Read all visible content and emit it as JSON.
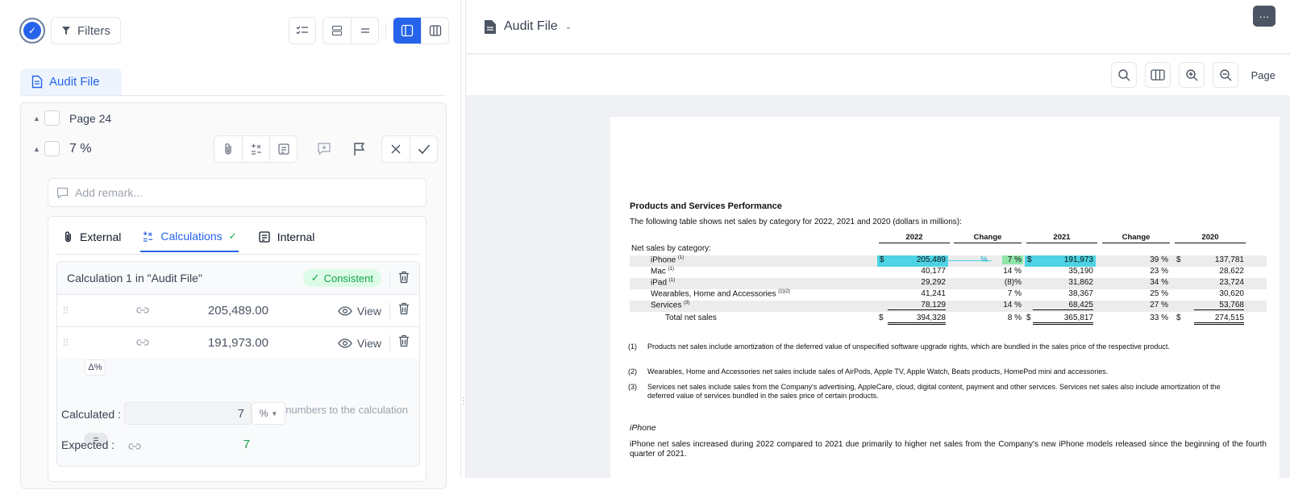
{
  "left": {
    "filters_label": "Filters",
    "audit_tab_label": "Audit File",
    "page_label": "Page 24",
    "item_label": "7 %",
    "remark_placeholder": "Add remark...",
    "tabs": [
      {
        "label": "External"
      },
      {
        "label": "Calculations"
      },
      {
        "label": "Internal"
      }
    ],
    "calc": {
      "title": "Calculation 1 in \"Audit File\"",
      "status": "Consistent",
      "operator": "Δ%",
      "numbers": [
        {
          "value": "205,489.00",
          "view_label": "View"
        },
        {
          "value": "191,973.00",
          "view_label": "View"
        }
      ],
      "add_numbers_label": "Add numbers to the calculation",
      "equals": "=",
      "calculated_label": "Calculated :",
      "calculated_value": "7",
      "unit": "%",
      "expected_label": "Expected :",
      "expected_value": "7"
    }
  },
  "right": {
    "title": "Audit File",
    "more_label": "···",
    "page_label": "Page"
  },
  "document": {
    "title": "Products and Services Performance",
    "subtitle": "The following table shows net sales by category for 2022, 2021 and 2020 (dollars in millions):",
    "headers": [
      "2022",
      "Change",
      "2021",
      "Change",
      "2020"
    ],
    "section_label": "Net sales by category:",
    "rows": [
      {
        "label": "iPhone",
        "sup": "(1)",
        "d1": "$",
        "v2022": "205,489",
        "chg1": "7 %",
        "d2": "$",
        "v2021": "191,973",
        "chg2": "39 %",
        "d3": "$",
        "v2020": "137,781"
      },
      {
        "label": "Mac",
        "sup": "(1)",
        "d1": "",
        "v2022": "40,177",
        "chg1": "14 %",
        "d2": "",
        "v2021": "35,190",
        "chg2": "23 %",
        "d3": "",
        "v2020": "28,622"
      },
      {
        "label": "iPad",
        "sup": "(1)",
        "d1": "",
        "v2022": "29,292",
        "chg1": "(8)%",
        "d2": "",
        "v2021": "31,862",
        "chg2": "34 %",
        "d3": "",
        "v2020": "23,724"
      },
      {
        "label": "Wearables, Home and Accessories",
        "sup": "(1)(2)",
        "d1": "",
        "v2022": "41,241",
        "chg1": "7 %",
        "d2": "",
        "v2021": "38,367",
        "chg2": "25 %",
        "d3": "",
        "v2020": "30,620"
      },
      {
        "label": "Services",
        "sup": "(3)",
        "d1": "",
        "v2022": "78,129",
        "chg1": "14 %",
        "d2": "",
        "v2021": "68,425",
        "chg2": "27 %",
        "d3": "",
        "v2020": "53,768"
      }
    ],
    "total": {
      "label": "Total net sales",
      "d1": "$",
      "v2022": "394,328",
      "chg1": "8 %",
      "d2": "$",
      "v2021": "365,817",
      "chg2": "33 %",
      "d3": "$",
      "v2020": "274,515"
    },
    "pct_marker": "%",
    "footnotes": [
      {
        "n": "(1)",
        "text": "Products net sales include amortization of the deferred value of unspecified software upgrade rights, which are bundled in the sales price of the respective product."
      },
      {
        "n": "(2)",
        "text": "Wearables, Home and Accessories net sales include sales of AirPods, Apple TV, Apple Watch, Beats products, HomePod mini and accessories."
      },
      {
        "n": "(3)",
        "text": "Services net sales include sales from the Company's advertising, AppleCare, cloud, digital content, payment and other services. Services net sales also include amortization of the deferred value of services bundled in the sales price of certain products."
      }
    ],
    "iphone_heading": "iPhone",
    "iphone_para": "iPhone net sales increased during 2022 compared to 2021 due primarily to higher net sales from the Company's new iPhone models released since the beginning of the fourth quarter of 2021."
  }
}
